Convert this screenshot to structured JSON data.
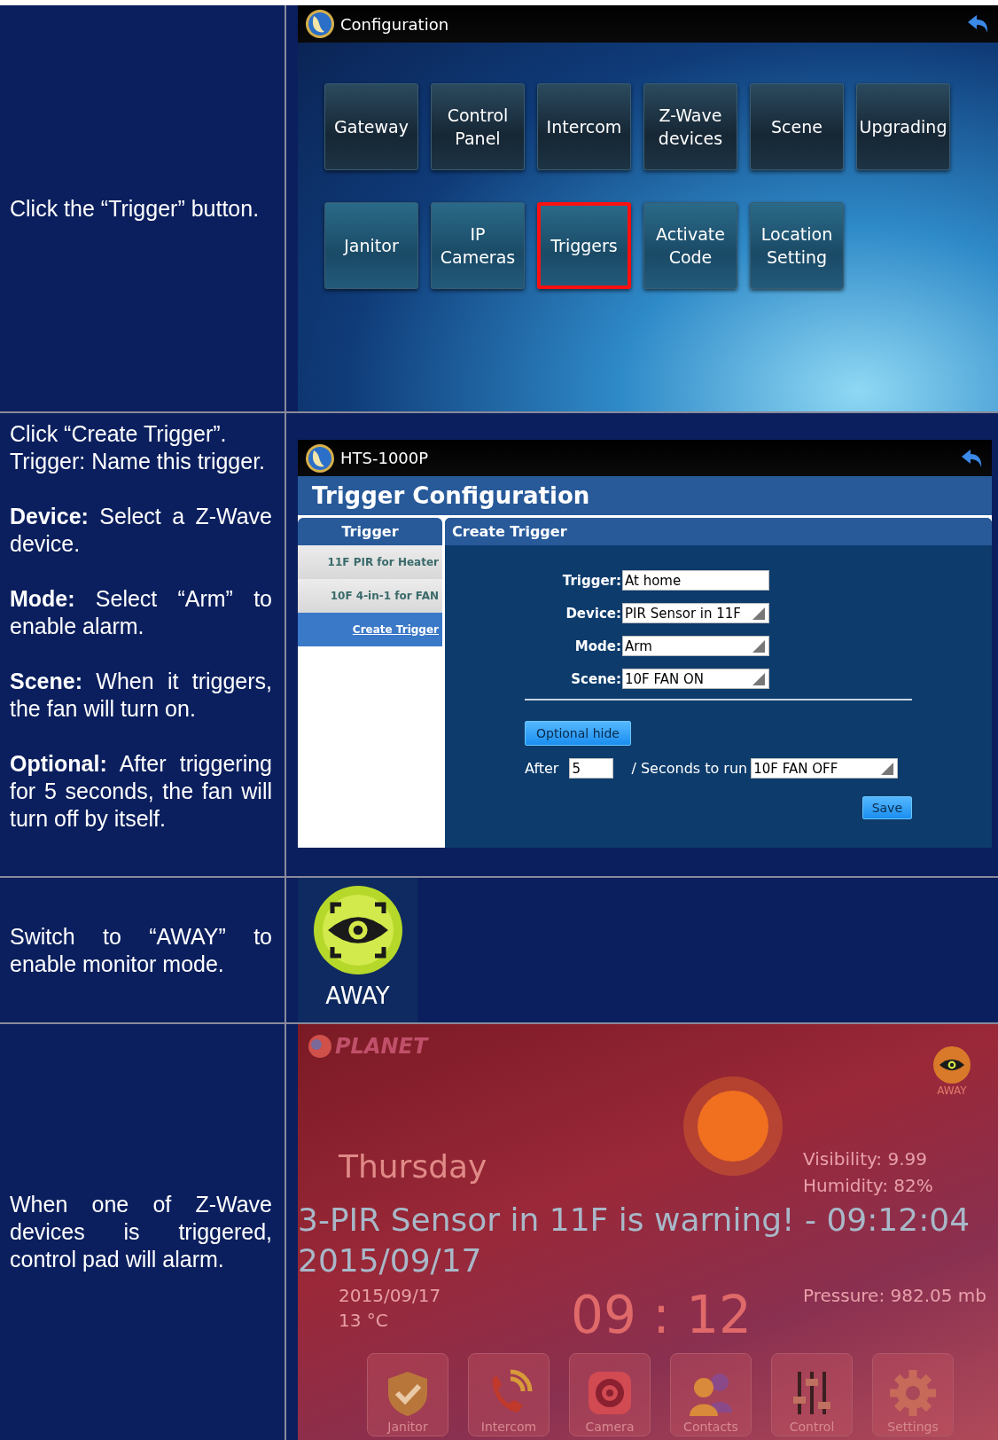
{
  "steps": [
    {
      "kind": "config_menu",
      "instruction": [
        "Click the “Trigger” button."
      ],
      "screen": {
        "title": "Configuration",
        "buttons": [
          {
            "label": "Gateway",
            "selected": false
          },
          {
            "label": "Control Panel",
            "selected": false
          },
          {
            "label": "Intercom",
            "selected": false
          },
          {
            "label": "Z-Wave devices",
            "selected": false
          },
          {
            "label": "Scene",
            "selected": false
          },
          {
            "label": "Upgrading",
            "selected": false
          },
          {
            "label": "Janitor",
            "selected": false
          },
          {
            "label": "IP Cameras",
            "selected": false
          },
          {
            "label": "Triggers",
            "selected": true
          },
          {
            "label": "Activate Code",
            "selected": false
          },
          {
            "label": "Location Setting",
            "selected": false
          }
        ]
      }
    },
    {
      "kind": "trigger_form",
      "instruction": [
        "Click “Create Trigger”.\nTrigger: Name this trigger.",
        "**Device:** Select a Z-Wave device.",
        "**Mode:** Select “Arm” to enable alarm.",
        "**Scene:** When it triggers, the fan will turn on.",
        "**Optional:** After triggering for 5 seconds, the fan will turn off by itself."
      ],
      "screen": {
        "title": "HTS-1000P",
        "heading": "Trigger Configuration",
        "sidebar": {
          "header": "Trigger",
          "items": [
            {
              "label": "11F PIR for Heater",
              "selected": false
            },
            {
              "label": "10F 4-in-1 for FAN",
              "selected": false
            },
            {
              "label": "Create Trigger",
              "selected": true
            }
          ]
        },
        "panel_title": "Create Trigger",
        "fields": [
          {
            "label": "Trigger:",
            "kind": "text",
            "value": "At home"
          },
          {
            "label": "Device:",
            "kind": "select",
            "value": "PIR Sensor in 11F"
          },
          {
            "label": "Mode:",
            "kind": "select",
            "value": "Arm"
          },
          {
            "label": "Scene:",
            "kind": "select",
            "value": "10F FAN ON"
          }
        ],
        "optional_button": "Optional hide",
        "after_label": "After",
        "after_value": "5",
        "run_label": "/ Seconds to run",
        "run_value": "10F FAN OFF",
        "save_button": "Save"
      }
    },
    {
      "kind": "mode_badge",
      "instruction": [
        "Switch to “AWAY” to enable monitor mode."
      ],
      "badge": {
        "label": "AWAY"
      }
    },
    {
      "kind": "alarm_screen",
      "instruction": [
        "When one of Z-Wave devices is triggered, control pad will alarm."
      ],
      "screen": {
        "logo": "PLANET",
        "mode_label": "AWAY",
        "day": "Thursday",
        "date": "2015/09/17",
        "temperature": "13 °C",
        "clock": "09 : 12",
        "weather": [
          "Visibility: 9.99",
          "Humidity: 82%",
          "Pressure: 982.05 mb"
        ],
        "warning": [
          "3-PIR Sensor in 11F is warning! - 09:12:04",
          "2015/09/17"
        ],
        "dock": [
          {
            "label": "Janitor",
            "kind": "shield"
          },
          {
            "label": "Intercom",
            "kind": "phone"
          },
          {
            "label": "Camera",
            "kind": "camera"
          },
          {
            "label": "Contacts",
            "kind": "contacts"
          },
          {
            "label": "Control",
            "kind": "sliders"
          },
          {
            "label": "Settings",
            "kind": "gear"
          }
        ]
      }
    }
  ]
}
